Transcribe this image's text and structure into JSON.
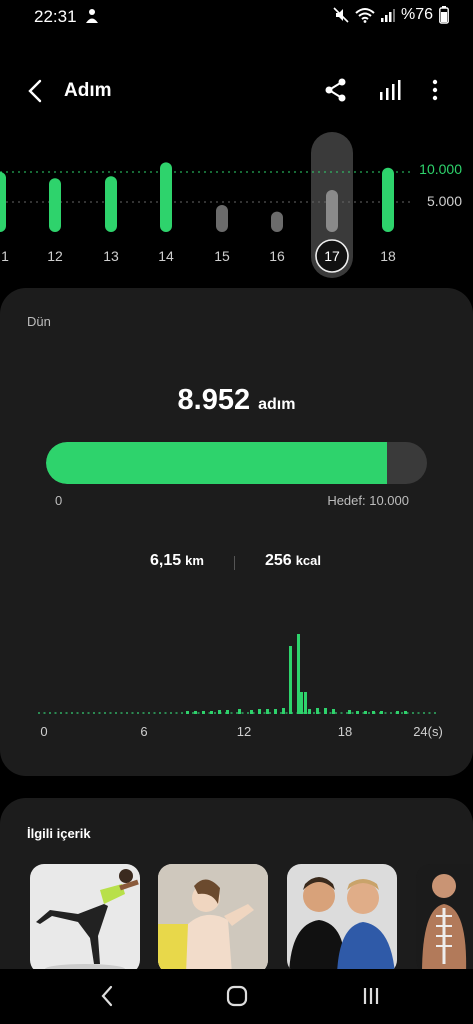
{
  "status_bar": {
    "time": "22:31",
    "battery_text": "%76",
    "icons": [
      "person-notification-icon",
      "mute-icon",
      "wifi-icon",
      "signal-icon",
      "battery-icon"
    ]
  },
  "header": {
    "title": "Adım",
    "icons": [
      "back-arrow-icon",
      "share-icon",
      "bar-chart-icon",
      "more-vertical-icon"
    ]
  },
  "daily_chart": {
    "days": [
      "1",
      "12",
      "13",
      "14",
      "15",
      "16",
      "17",
      "18"
    ],
    "selected_day": "17",
    "goal_labels": [
      "10.000",
      "5.000"
    ],
    "colors": {
      "met": "#2ed36c",
      "unmet": "#6b6b6b",
      "goal_line": "#2ed36c"
    }
  },
  "summary": {
    "period": "Dün",
    "steps": "8.952",
    "steps_unit": "adım",
    "progress_fraction": 0.8952,
    "min_label": "0",
    "goal_label": "Hedef: 10.000",
    "distance": "6,15",
    "distance_unit": "km",
    "calories": "256",
    "calories_unit": "kcal"
  },
  "hourly_chart": {
    "x_ticks": [
      "0",
      "6",
      "12",
      "18",
      "24(s)"
    ]
  },
  "related": {
    "title": "İlgili içerik",
    "items": [
      "fitness-woman-image",
      "stretching-woman-image",
      "two-men-image",
      "anatomy-man-image"
    ]
  },
  "nav": {
    "icons": [
      "recent-apps-icon",
      "home-icon",
      "back-nav-icon"
    ]
  },
  "chart_data": {
    "type": "bar",
    "categories": [
      "1",
      "12",
      "13",
      "14",
      "15",
      "16",
      "17",
      "18"
    ],
    "values": [
      10000,
      8952,
      9300,
      11600,
      4500,
      3400,
      7000,
      10700
    ],
    "ylim": [
      0,
      16000
    ]
  }
}
